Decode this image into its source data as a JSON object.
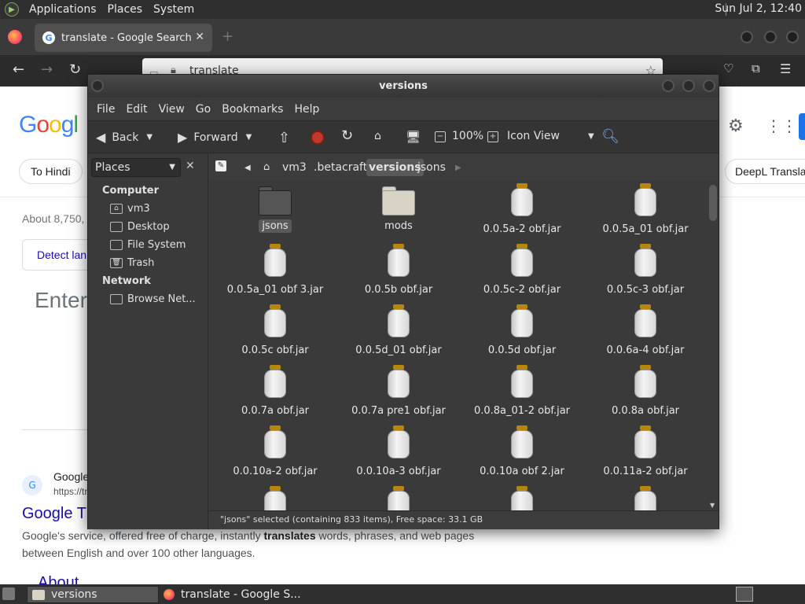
{
  "top_panel": {
    "menus": [
      "Applications",
      "Places",
      "System"
    ],
    "clock": "Sun Jul  2, 12:40"
  },
  "browser": {
    "tab_title": "translate - Google Search",
    "url": "translate",
    "page": {
      "logo_letters": [
        "G",
        "o",
        "o",
        "g",
        "l"
      ],
      "chip_hindi": "To Hindi",
      "chip_deepl": "DeepL Transla",
      "about": "About 8,750,",
      "detect": "Detect lan",
      "enter": "Enter",
      "result_site": "Google",
      "result_url": "https://tr",
      "result_title": "Google T",
      "snippet_pre": "Google's service, offered free of charge, instantly ",
      "snippet_bold": "translates",
      "snippet_post": " words, phrases, and web pages between English and over 100 other languages.",
      "result_about": "About"
    }
  },
  "file_manager": {
    "title": "versions",
    "menus": [
      "File",
      "Edit",
      "View",
      "Go",
      "Bookmarks",
      "Help"
    ],
    "toolbar": {
      "back": "Back",
      "forward": "Forward",
      "zoom": "100%",
      "view_mode": "Icon View"
    },
    "sidebar": {
      "selector": "Places",
      "computer_heading": "Computer",
      "computer_items": [
        "vm3",
        "Desktop",
        "File System",
        "Trash"
      ],
      "network_heading": "Network",
      "network_items": [
        "Browse Net..."
      ]
    },
    "path": [
      "vm3",
      ".betacraft",
      "versions",
      "jsons"
    ],
    "items": [
      {
        "name": "jsons",
        "type": "folder-dark",
        "selected": true
      },
      {
        "name": "mods",
        "type": "folder-light"
      },
      {
        "name": "0.0.5a-2 obf.jar",
        "type": "jar"
      },
      {
        "name": "0.0.5a_01 obf.jar",
        "type": "jar"
      },
      {
        "name": "0.0.5a_01 obf 3.jar",
        "type": "jar"
      },
      {
        "name": "0.0.5b obf.jar",
        "type": "jar"
      },
      {
        "name": "0.0.5c-2 obf.jar",
        "type": "jar"
      },
      {
        "name": "0.0.5c-3 obf.jar",
        "type": "jar"
      },
      {
        "name": "0.0.5c obf.jar",
        "type": "jar"
      },
      {
        "name": "0.0.5d_01 obf.jar",
        "type": "jar"
      },
      {
        "name": "0.0.5d obf.jar",
        "type": "jar"
      },
      {
        "name": "0.0.6a-4 obf.jar",
        "type": "jar"
      },
      {
        "name": "0.0.7a obf.jar",
        "type": "jar"
      },
      {
        "name": "0.0.7a pre1 obf.jar",
        "type": "jar"
      },
      {
        "name": "0.0.8a_01-2 obf.jar",
        "type": "jar"
      },
      {
        "name": "0.0.8a obf.jar",
        "type": "jar"
      },
      {
        "name": "0.0.10a-2 obf.jar",
        "type": "jar"
      },
      {
        "name": "0.0.10a-3 obf.jar",
        "type": "jar"
      },
      {
        "name": "0.0.10a obf 2.jar",
        "type": "jar"
      },
      {
        "name": "0.0.11a-2 obf.jar",
        "type": "jar"
      },
      {
        "name": "",
        "type": "jar"
      },
      {
        "name": "",
        "type": "jar"
      },
      {
        "name": "",
        "type": "jar"
      },
      {
        "name": "",
        "type": "jar"
      }
    ],
    "status": "\"jsons\" selected (containing 833 items), Free space: 33.1 GB"
  },
  "taskbar": {
    "tasks": [
      "versions",
      "translate - Google S..."
    ]
  }
}
